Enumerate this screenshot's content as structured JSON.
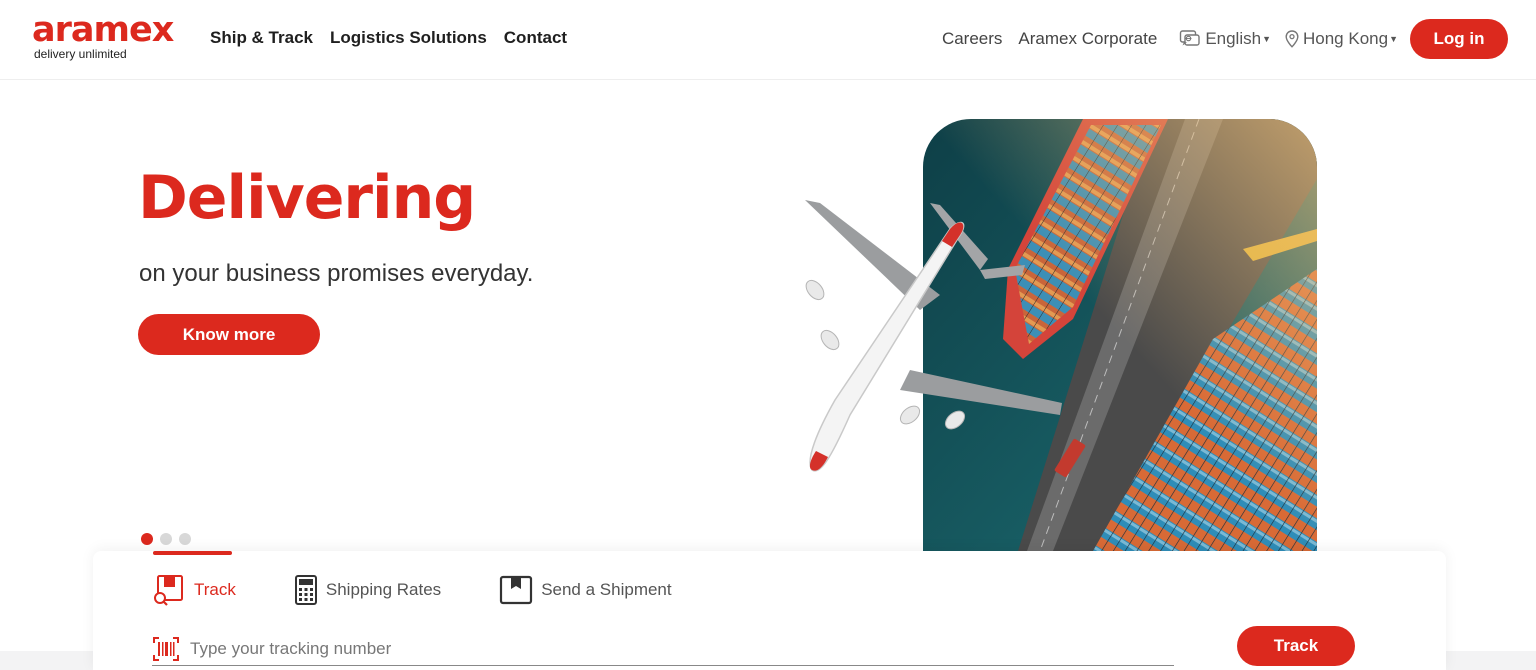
{
  "brand": {
    "logo_text": "aramex",
    "tagline": "delivery unlimited",
    "accent_color": "#dc291e"
  },
  "nav": {
    "left_items": [
      "Ship & Track",
      "Logistics Solutions",
      "Contact"
    ],
    "careers": "Careers",
    "corporate": "Aramex Corporate",
    "language": "English",
    "region": "Hong Kong",
    "login_label": "Log in"
  },
  "hero": {
    "title": "Delivering",
    "subtitle": "on your business promises everyday.",
    "cta_label": "Know more",
    "slide_count": 3,
    "active_slide": 1
  },
  "tracking": {
    "tabs": [
      {
        "label": "Track",
        "icon": "track-icon",
        "active": true
      },
      {
        "label": "Shipping Rates",
        "icon": "calculator-icon",
        "active": false
      },
      {
        "label": "Send a Shipment",
        "icon": "package-icon",
        "active": false
      }
    ],
    "input_placeholder": "Type your tracking number",
    "input_value": "",
    "button_label": "Track"
  }
}
